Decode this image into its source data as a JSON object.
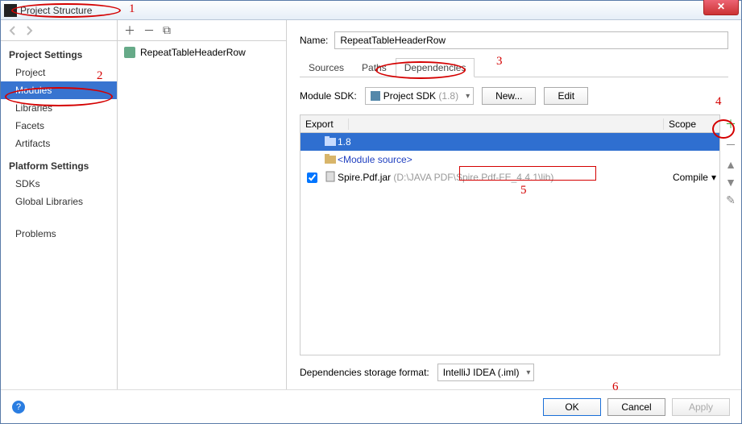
{
  "title": "Project Structure",
  "nav": {
    "settings_header": "Project Settings",
    "items1": [
      "Project",
      "Modules",
      "Libraries",
      "Facets",
      "Artifacts"
    ],
    "selected1": 1,
    "platform_header": "Platform Settings",
    "items2": [
      "SDKs",
      "Global Libraries"
    ],
    "problems": "Problems"
  },
  "module_list": {
    "items": [
      "RepeatTableHeaderRow"
    ]
  },
  "main": {
    "name_label": "Name:",
    "name_value": "RepeatTableHeaderRow",
    "tabs": [
      "Sources",
      "Paths",
      "Dependencies"
    ],
    "active_tab": 2,
    "sdk_label": "Module SDK:",
    "sdk_value_prefix": "Project SDK",
    "sdk_value_suffix": "(1.8)",
    "btn_new": "New...",
    "btn_edit": "Edit",
    "table": {
      "col_export": "Export",
      "col_scope": "Scope",
      "rows": [
        {
          "check": false,
          "icon": "folder",
          "text": "1.8",
          "sel": true
        },
        {
          "check": false,
          "icon": "folder",
          "html": "<span class='msrc'>&lt;Module source&gt;</span>"
        },
        {
          "check": true,
          "icon": "jar",
          "html": "Spire.Pdf.jar <span class='dimtxt'>(D:\\JAVA PDF\\Spire.Pdf-FE_4.4.1\\lib)</span>",
          "scope": "Compile"
        }
      ]
    },
    "fmt_label": "Dependencies storage format:",
    "fmt_value": "IntelliJ IDEA (.iml)"
  },
  "footer": {
    "ok": "OK",
    "cancel": "Cancel",
    "apply": "Apply"
  },
  "annotations": [
    "1",
    "2",
    "3",
    "4",
    "5",
    "6"
  ]
}
